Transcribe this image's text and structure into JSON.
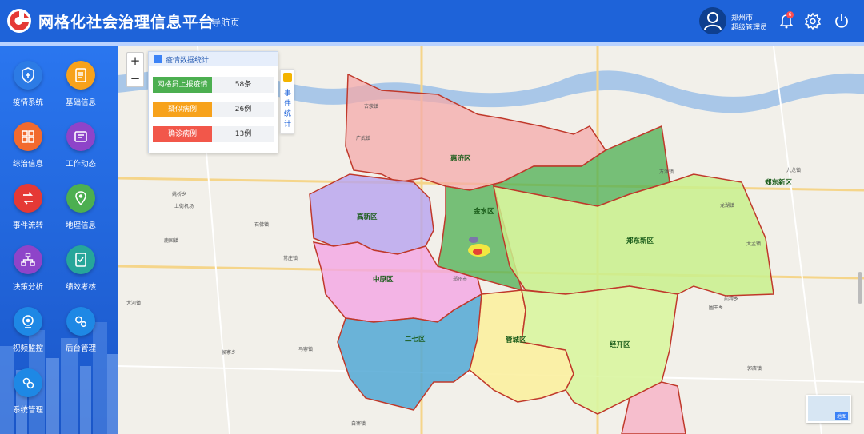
{
  "header": {
    "title": "网格化社会治理信息平台",
    "subtitle": "—— 导航页",
    "user": {
      "city": "郑州市",
      "role": "超级管理员"
    },
    "bell_badge": "6",
    "colors": {
      "bar": "#1e63d9",
      "logo": "#e53935"
    }
  },
  "sidebar": {
    "items": [
      {
        "label": "疫情系统",
        "icon": "shield-plus-icon",
        "color": "#2c7be5"
      },
      {
        "label": "基础信息",
        "icon": "document-icon",
        "color": "#f7a21b"
      },
      {
        "label": "综治信息",
        "icon": "grid-icon",
        "color": "#f26a2e"
      },
      {
        "label": "工作动态",
        "icon": "news-icon",
        "color": "#8e44c9"
      },
      {
        "label": "事件流转",
        "icon": "flow-icon",
        "color": "#e53935"
      },
      {
        "label": "地理信息",
        "icon": "location-pin-icon",
        "color": "#4caf50"
      },
      {
        "label": "决策分析",
        "icon": "org-chart-icon",
        "color": "#8e44c9"
      },
      {
        "label": "绩效考核",
        "icon": "checklist-icon",
        "color": "#26a69a"
      },
      {
        "label": "视频监控",
        "icon": "camera-icon",
        "color": "#1e88e5"
      },
      {
        "label": "后台管理",
        "icon": "gears-icon",
        "color": "#1e88e5"
      },
      {
        "label": "系统管理",
        "icon": "settings-icon",
        "color": "#1e88e5"
      }
    ]
  },
  "map": {
    "zoom_in": "+",
    "zoom_out": "−",
    "panel": {
      "title": "疫情数据统计",
      "rows": [
        {
          "label": "网格员上报疫情",
          "value": "58条",
          "color": "#4caf50"
        },
        {
          "label": "疑似病例",
          "value": "26例",
          "color": "#f7a21b"
        },
        {
          "label": "确诊病例",
          "value": "13例",
          "color": "#f2574a"
        }
      ]
    },
    "side_tab": "事件统计",
    "districts": {
      "huiji": "惠济区",
      "jinshui": "金水区",
      "zhengdong": "郑东新区",
      "zhengdong_east": "郑东新区",
      "gaoxin": "高新区",
      "zhongyuan": "中原区",
      "erqi": "二七区",
      "guancheng": "管城区",
      "jingkai": "经开区"
    },
    "places": {
      "p1": "姚桥乡",
      "p2": "上街机场",
      "p3": "鹿国镇",
      "p4": "石佛镇",
      "p5": "常庄镇",
      "p6": "大河镇",
      "p7": "侯寨乡",
      "p8": "马寨镇",
      "p9": "龙湖镇",
      "p10": "白寨镇",
      "p11": "郑州市",
      "p12": "圃田乡",
      "p13": "万滩镇",
      "p14": "大孟镇",
      "p15": "九龙镇",
      "p16": "前程乡",
      "p17": "郭店镇",
      "p18": "古荥镇",
      "p19": "广武镇"
    },
    "minimap_label": "地图"
  }
}
